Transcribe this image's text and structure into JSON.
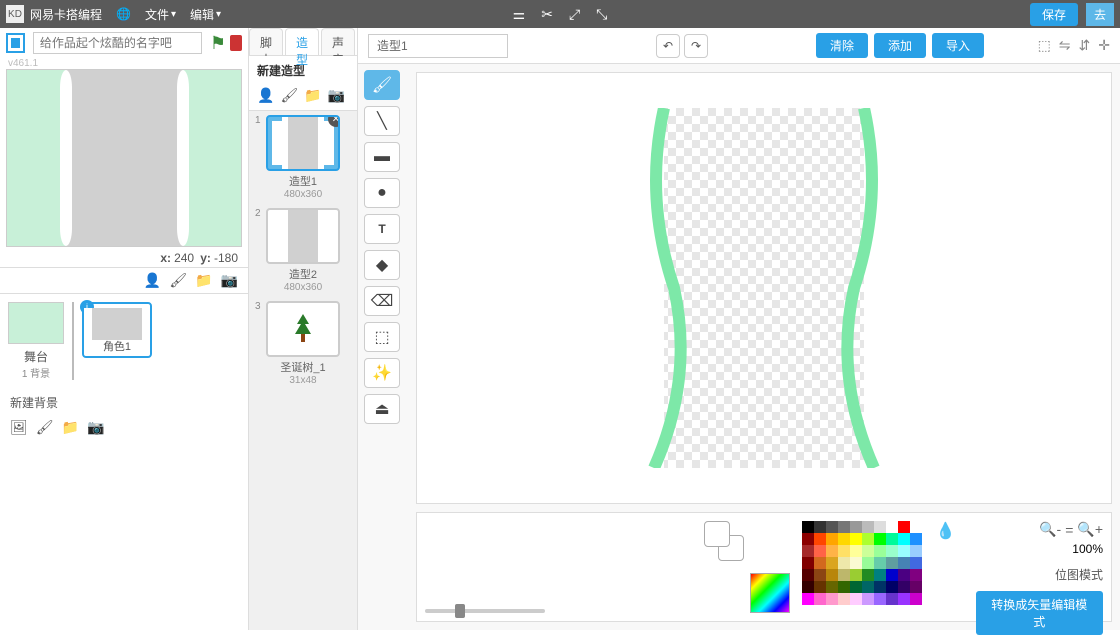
{
  "topbar": {
    "brand": "网易卡搭编程",
    "file_menu": "文件",
    "edit_menu": "编辑",
    "save_label": "保存",
    "go_label": "去"
  },
  "left": {
    "title_placeholder": "给作品起个炫酷的名字吧",
    "version": "v461.1",
    "coord_x_label": "x:",
    "coord_x": "240",
    "coord_y_label": "y:",
    "coord_y": "-180",
    "stage_label": "舞台",
    "stage_sub": "1 背景",
    "sprite_name": "角色1",
    "new_bg_label": "新建背景"
  },
  "tabs": {
    "scripts": "脚本",
    "costumes": "造型",
    "sounds": "声音"
  },
  "costumes": {
    "new_label": "新建造型",
    "list": [
      {
        "name": "造型1",
        "dims": "480x360"
      },
      {
        "name": "造型2",
        "dims": "480x360"
      },
      {
        "name": "圣诞树_1",
        "dims": "31x48"
      }
    ]
  },
  "editor": {
    "name_value": "造型1",
    "clear": "清除",
    "add": "添加",
    "import": "导入",
    "zoom_pct": "100%",
    "mode_label": "位图模式",
    "convert": "转换成矢量编辑模式"
  },
  "palette_rows": [
    [
      "#000000",
      "#333333",
      "#555555",
      "#777777",
      "#999999",
      "#bbbbbb",
      "#dddddd",
      "#ffffff",
      "#ff0000",
      "#ffffff"
    ],
    [
      "#8b0000",
      "#ff4500",
      "#ffa500",
      "#ffd700",
      "#ffff00",
      "#adff2f",
      "#00ff00",
      "#00fa9a",
      "#00ffff",
      "#1e90ff"
    ],
    [
      "#a52a2a",
      "#ff6347",
      "#ffb347",
      "#ffe066",
      "#ffff99",
      "#ccff99",
      "#99ff99",
      "#99ffcc",
      "#99ffff",
      "#99ccff"
    ],
    [
      "#800000",
      "#d2691e",
      "#daa520",
      "#eee8aa",
      "#fafad2",
      "#98fb98",
      "#66cdaa",
      "#5f9ea0",
      "#4682b4",
      "#4169e1"
    ],
    [
      "#550000",
      "#8b4513",
      "#b8860b",
      "#bdb76b",
      "#9acd32",
      "#228b22",
      "#008080",
      "#0000cd",
      "#4b0082",
      "#800080"
    ],
    [
      "#330000",
      "#663300",
      "#666600",
      "#336600",
      "#006633",
      "#006666",
      "#003366",
      "#000066",
      "#330066",
      "#660066"
    ],
    [
      "#ff00ff",
      "#ff66cc",
      "#ff99cc",
      "#ffcccc",
      "#ffccff",
      "#cc99ff",
      "#9966ff",
      "#6633cc",
      "#9933ff",
      "#cc00cc"
    ]
  ]
}
